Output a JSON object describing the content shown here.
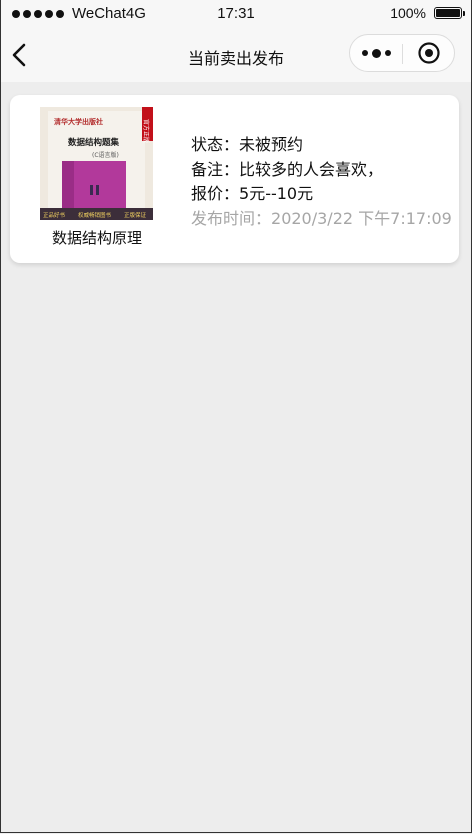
{
  "status_bar": {
    "carrier": "WeChat4G",
    "time": "17:31",
    "battery": "100%",
    "battery_level": 1.0
  },
  "nav": {
    "title": "当前卖出发布"
  },
  "listing": {
    "book_title": "数据结构原理",
    "cover_texts": {
      "publisher": "清华大学出版社",
      "seal": "官方正版",
      "book_title": "数据结构题集",
      "subtitle": "(C语言版)",
      "banner_left": "正品好书",
      "banner_mid": "权威畅销图书",
      "banner_right": "正版保证"
    },
    "status_label": "状态：",
    "status_value": "未被预约",
    "note_label": "备注：",
    "note_value": "比较多的人会喜欢，",
    "price_label": "报价：",
    "price_value": "5元--10元",
    "time_label": "发布时间：",
    "time_value": "2020/3/22 下午7:17:09"
  },
  "colors": {
    "background": "#ededed",
    "nav_background": "#f7f7f7",
    "card_background": "#ffffff",
    "muted_text": "#a6a6a6",
    "cover_magenta": "#b2399b"
  },
  "icons": {
    "back": "chevron-left-icon",
    "more": "more-dots-icon",
    "close": "target-circle-icon"
  }
}
